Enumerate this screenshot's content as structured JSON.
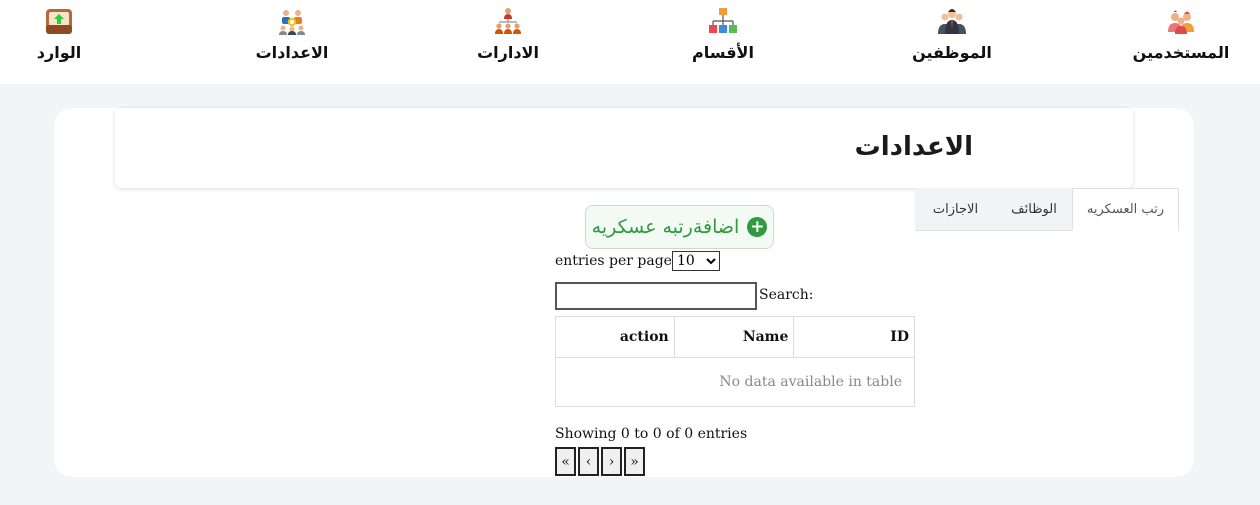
{
  "nav": {
    "items": [
      {
        "label": "المستخدمين",
        "icon": "users-icon"
      },
      {
        "label": "الموظفين",
        "icon": "employees-icon"
      },
      {
        "label": "الأقسام",
        "icon": "departments-icon"
      },
      {
        "label": "الادارات",
        "icon": "administrations-icon"
      },
      {
        "label": "الاعدادات",
        "icon": "settings-team-icon"
      },
      {
        "label": "الوارد",
        "icon": "inbox-icon"
      }
    ]
  },
  "page": {
    "title": "الاعدادات"
  },
  "tabs": [
    {
      "label": "رتب العسكريه",
      "active": true
    },
    {
      "label": "الوظائف",
      "active": false
    },
    {
      "label": "الاجازات",
      "active": false
    }
  ],
  "add_button": {
    "label": "اضافةرتبه عسكريه",
    "icon": "plus-circle-icon",
    "color": "#2e9b40"
  },
  "table_controls": {
    "page_size": "10",
    "entries_label": "entries per page",
    "search_label": "Search:",
    "search_value": ""
  },
  "table": {
    "columns": [
      "ID",
      "Name",
      "action"
    ],
    "empty_text": "No data available in table"
  },
  "info": {
    "showing": "Showing 0 to 0 of 0 entries"
  },
  "pagination": [
    "«",
    "‹",
    "›",
    "»"
  ]
}
